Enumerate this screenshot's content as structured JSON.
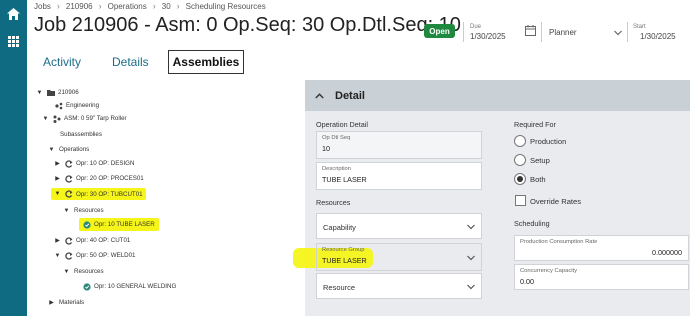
{
  "breadcrumb": [
    "Jobs",
    "210906",
    "Operations",
    "30",
    "Scheduling Resources"
  ],
  "title": "Job 210906 - Asm: 0 Op.Seq: 30 Op.Dtl.Seq: 10",
  "status": "Open",
  "header_fields": {
    "due_label": "Due",
    "due_value": "1/30/2025",
    "planner_value": "Planner",
    "start_label": "Start",
    "start_value": "1/30/2025"
  },
  "tabs": [
    "Activity",
    "Details",
    "Assemblies"
  ],
  "tree": {
    "job": "210906",
    "engineering": "Engineering",
    "asm": "ASM: 0 59\" Tarp Roller",
    "subassemblies": "Subassemblies",
    "operations": "Operations",
    "ops": [
      "Opr: 10 OP: DESIGN",
      "Opr: 20 OP: PROCES01",
      "Opr: 30 OP: TUBCUT01",
      "Opr: 40 OP: CUT01",
      "Opr: 50 OP: WELD01"
    ],
    "resources": "Resources",
    "res_30": "Opr: 10 TUBE LASER",
    "res_50": "Opr: 10 GENERAL WELDING",
    "materials": "Materials"
  },
  "detail": {
    "header": "Detail",
    "operation_detail": "Operation Detail",
    "op_dtl_seq_label": "Op Dtl Seq",
    "op_dtl_seq_value": "10",
    "description_label": "Description",
    "description_value": "TUBE LASER",
    "resources_section": "Resources",
    "capability": "Capability",
    "resource_group_label": "Resource Group",
    "resource_group_value": "TUBE LASER",
    "resource": "Resource",
    "required_for": "Required For",
    "radios": [
      "Production",
      "Setup",
      "Both"
    ],
    "selected_radio": "Both",
    "override_rates": "Override Rates",
    "scheduling": "Scheduling",
    "prod_consumption_label": "Production Consumption Rate",
    "prod_consumption_value": "0.000000",
    "concurrency_label": "Concurrency Capacity",
    "concurrency_value": "0.00"
  },
  "colors": {
    "rail": "#0f6b82",
    "status_green": "#1f8a3f",
    "highlight": "#f5f51a",
    "link": "#1c6e86"
  }
}
